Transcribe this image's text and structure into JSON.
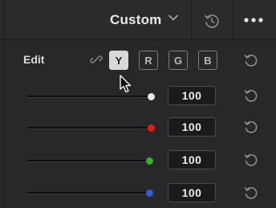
{
  "header": {
    "title": "Custom"
  },
  "edit": {
    "label": "Edit",
    "channels": [
      {
        "label": "Y",
        "active": true
      },
      {
        "label": "R",
        "active": false
      },
      {
        "label": "G",
        "active": false
      },
      {
        "label": "B",
        "active": false
      }
    ]
  },
  "sliders": [
    {
      "channel": "luma",
      "value": "100",
      "color": "#e8e8e8"
    },
    {
      "channel": "red",
      "value": "100",
      "color": "#e31b1b"
    },
    {
      "channel": "green",
      "value": "100",
      "color": "#34b233"
    },
    {
      "channel": "blue",
      "value": "100",
      "color": "#3a57d8"
    }
  ],
  "icons": {
    "chevron": "chevron-down-icon",
    "header_reset": "history-reset-icon",
    "more": "more-dots-icon",
    "link": "link-icon",
    "reset": "reset-icon",
    "cursor": "mouse-pointer-icon"
  }
}
